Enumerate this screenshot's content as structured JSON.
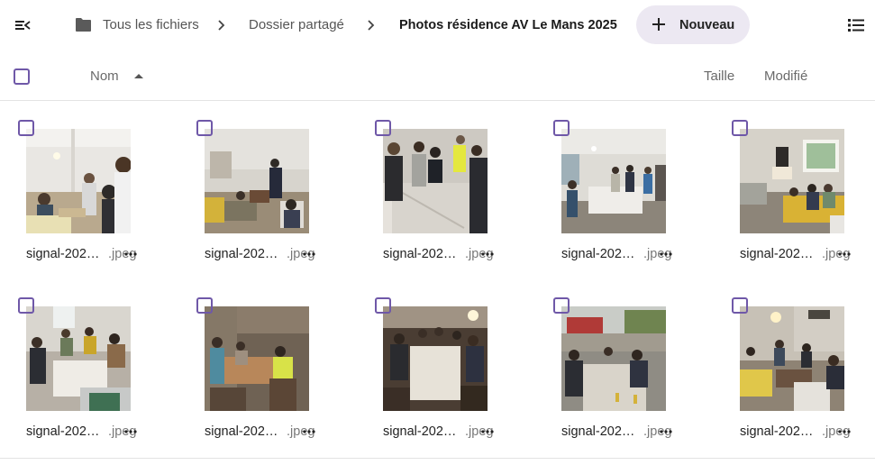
{
  "header": {
    "nav_toggle_icon": "menu-collapse-icon",
    "folder_icon": "folder-icon",
    "breadcrumbs": [
      "Tous les fichiers",
      "Dossier partagé",
      "Photos résidence AV Le Mans 2025"
    ],
    "new_button_label": "Nouveau",
    "view_toggle_icon": "list-view-icon"
  },
  "columns": {
    "name": "Nom",
    "size": "Taille",
    "modified": "Modifié",
    "sort_direction": "ascending"
  },
  "colors": {
    "accent": "#6f58a8",
    "new_button_bg": "#ece8f2"
  },
  "files": [
    {
      "name": "signal-202…",
      "ext": ".jpeg"
    },
    {
      "name": "signal-202…",
      "ext": ".jpeg"
    },
    {
      "name": "signal-202…",
      "ext": ".jpeg"
    },
    {
      "name": "signal-202…",
      "ext": ".jpeg"
    },
    {
      "name": "signal-202…",
      "ext": ".jpeg"
    },
    {
      "name": "signal-202…",
      "ext": ".jpeg"
    },
    {
      "name": "signal-202…",
      "ext": ".jpeg"
    },
    {
      "name": "signal-202…",
      "ext": ".jpeg"
    },
    {
      "name": "signal-202…",
      "ext": ".jpeg"
    },
    {
      "name": "signal-202…",
      "ext": ".jpeg"
    }
  ]
}
